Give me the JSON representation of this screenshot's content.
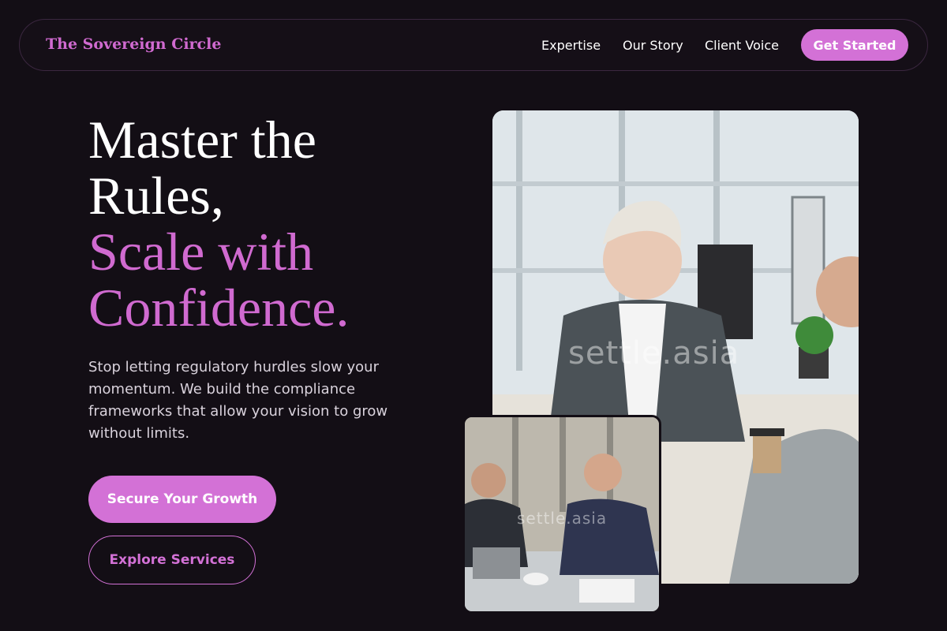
{
  "brand": {
    "name": "The Sovereign Circle"
  },
  "nav": {
    "links": [
      {
        "label": "Expertise"
      },
      {
        "label": "Our Story"
      },
      {
        "label": "Client Voice"
      }
    ],
    "cta_label": "Get Started"
  },
  "hero": {
    "headline_line1": "Master the",
    "headline_line2": "Rules,",
    "headline_accent_line1": "Scale with",
    "headline_accent_line2": "Confidence.",
    "description": "Stop letting regulatory hurdles slow your momentum. We build the compliance frameworks that allow your vision to grow without limits.",
    "primary_button_label": "Secure Your Growth",
    "secondary_button_label": "Explore Services"
  },
  "images": {
    "main_watermark": "settle.asia",
    "small_watermark": "settle.asia"
  },
  "colors": {
    "background": "#130e15",
    "accent": "#d371d6",
    "text": "#ffffff",
    "muted_text": "#d9d2dc"
  }
}
